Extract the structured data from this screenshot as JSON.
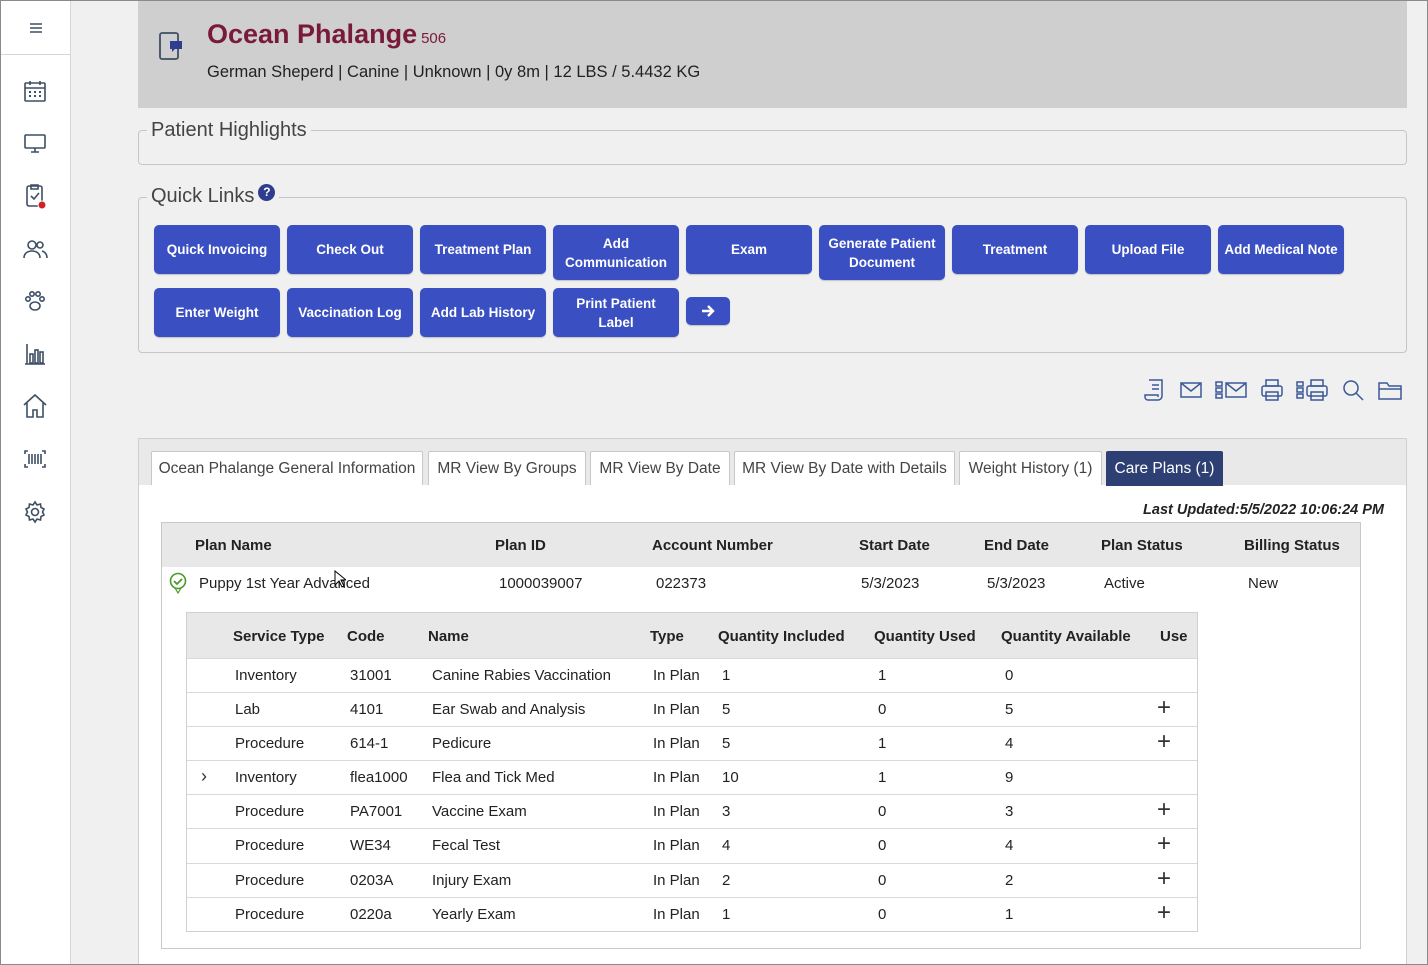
{
  "header": {
    "pet_name": "Ocean Phalange",
    "pet_id": "506",
    "pet_details": "German Sheperd | Canine | Unknown | 0y 8m | 12 LBS / 5.4432 KG"
  },
  "highlights": {
    "legend": "Patient Highlights"
  },
  "quick_links": {
    "legend": "Quick Links",
    "help": "?",
    "buttons": [
      "Quick Invoicing",
      "Check Out",
      "Treatment Plan",
      "Add Communication",
      "Exam",
      "Generate Patient Document",
      "Treatment",
      "Upload File",
      "Add Medical Note",
      "Enter Weight",
      "Vaccination Log",
      "Add Lab History",
      "Print Patient Label"
    ]
  },
  "toolbar_icons": [
    "receipt-icon",
    "email-icon",
    "bulk-email-icon",
    "print-icon",
    "bulk-print-icon",
    "search-icon",
    "folder-icon"
  ],
  "tabs": [
    "Ocean Phalange General Information",
    "MR View By Groups",
    "MR View By Date",
    "MR View By Date with Details",
    "Weight History (1)",
    "Care Plans (1)"
  ],
  "last_updated": "Last Updated:5/5/2022 10:06:24 PM",
  "plan_table": {
    "headers": [
      "Plan Name",
      "Plan ID",
      "Account Number",
      "Start Date",
      "End Date",
      "Plan Status",
      "Billing Status"
    ],
    "row": [
      "Puppy 1st Year Advanced",
      "1000039007",
      "022373",
      "5/3/2023",
      "5/3/2023",
      "Active",
      "New"
    ]
  },
  "service_table": {
    "headers": [
      "Service Type",
      "Code",
      "Name",
      "Type",
      "Quantity Included",
      "Quantity Used",
      "Quantity Available",
      "Use"
    ],
    "rows": [
      [
        "Inventory",
        "31001",
        "Canine Rabies Vaccination",
        "In Plan",
        "1",
        "1",
        "0"
      ],
      [
        "Lab",
        "4101",
        "Ear Swab and Analysis",
        "In Plan",
        "5",
        "0",
        "5"
      ],
      [
        "Procedure",
        "614-1",
        "Pedicure",
        "In Plan",
        "5",
        "1",
        "4"
      ],
      [
        "Inventory",
        "flea1000",
        "Flea and Tick Med",
        "In Plan",
        "10",
        "1",
        "9"
      ],
      [
        "Procedure",
        "PA7001",
        "Vaccine Exam",
        "In Plan",
        "3",
        "0",
        "3"
      ],
      [
        "Procedure",
        "WE34",
        "Fecal Test",
        "In Plan",
        "4",
        "0",
        "4"
      ],
      [
        "Procedure",
        "0203A",
        "Injury Exam",
        "In Plan",
        "2",
        "0",
        "2"
      ],
      [
        "Procedure",
        "0220a",
        "Yearly Exam",
        "In Plan",
        "1",
        "0",
        "1"
      ]
    ]
  }
}
